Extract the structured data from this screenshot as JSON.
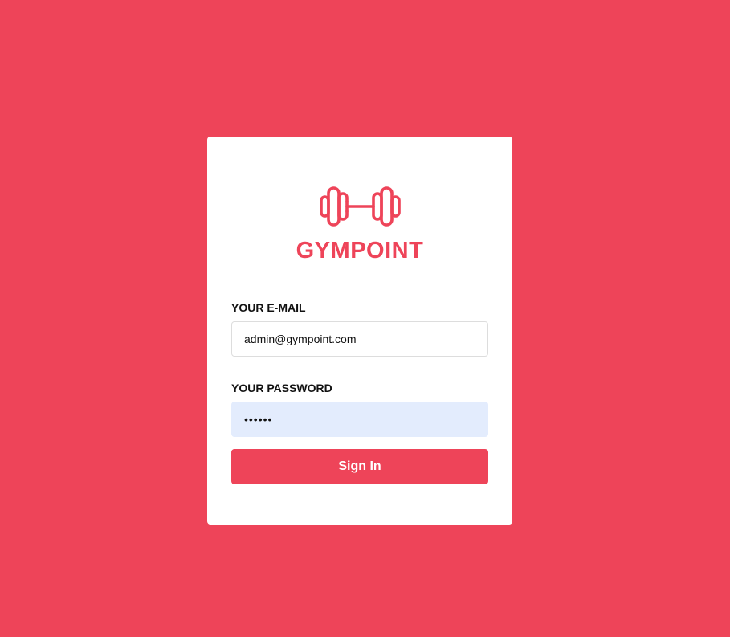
{
  "brand": {
    "name": "GYMPOINT",
    "icon": "dumbbell-icon",
    "color": "#ee4459"
  },
  "form": {
    "email_label": "YOUR E-MAIL",
    "email_value": "admin@gympoint.com",
    "password_label": "YOUR PASSWORD",
    "password_value": "••••••",
    "submit_label": "Sign In"
  },
  "colors": {
    "background": "#ee4459",
    "card": "#ffffff",
    "password_autofill_bg": "#e3ecfd"
  }
}
